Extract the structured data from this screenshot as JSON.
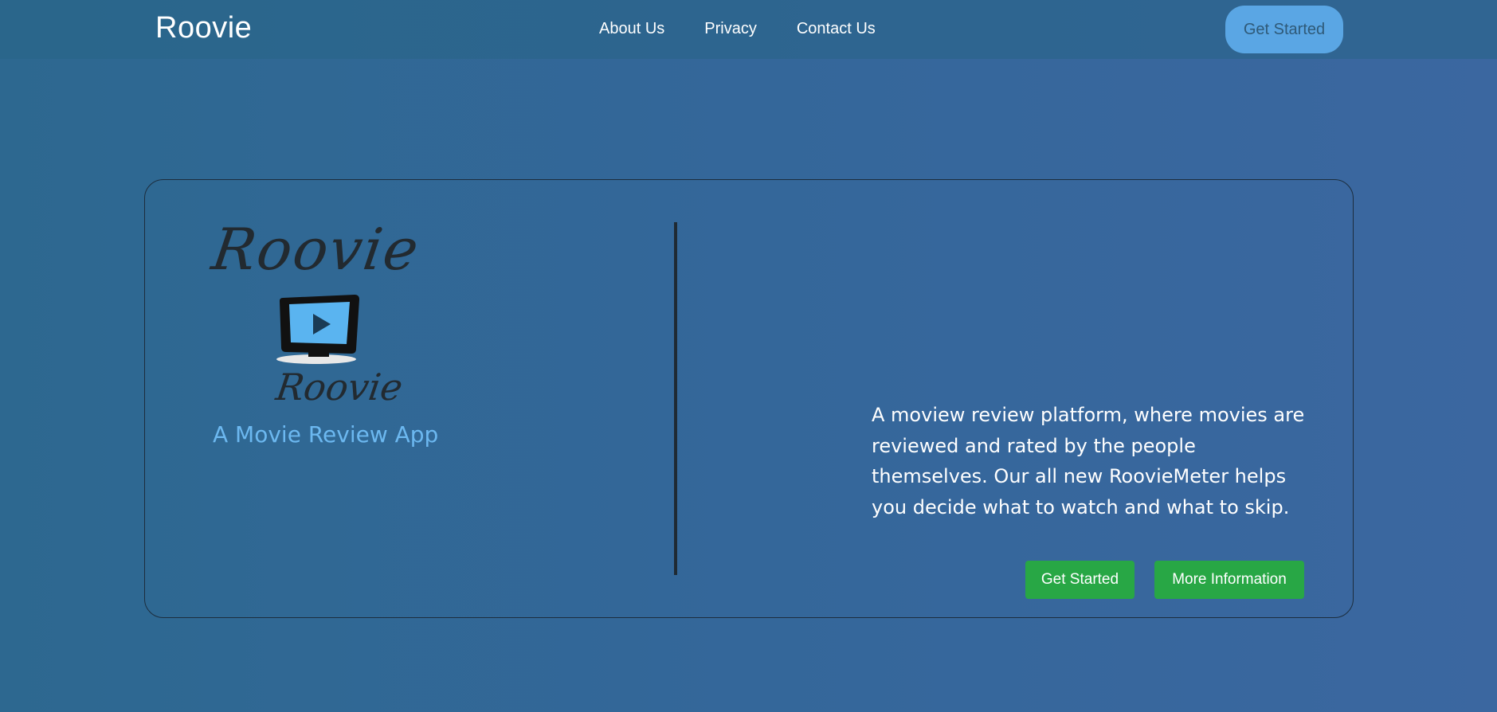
{
  "navbar": {
    "brand": "Roovie",
    "links": [
      "About Us",
      "Privacy",
      "Contact Us"
    ],
    "cta_label": "Get Started"
  },
  "hero": {
    "logo": {
      "script_top": "Roovie",
      "script_bottom": "Roovie",
      "tagline": "A Movie Review App",
      "icon": "tv-play-icon"
    },
    "description": "A moview review platform, where movies are reviewed and rated by the people themselves. Our all new RoovieMeter helps you decide what to watch and what to skip.",
    "primary_button": "Get Started",
    "secondary_button": "More Information"
  },
  "colors": {
    "background_start": "#2d6890",
    "background_end": "#3b67a0",
    "nav_cta": "#5aa6e4",
    "button_green": "#28a745",
    "tagline_blue": "#6cb8f0"
  }
}
